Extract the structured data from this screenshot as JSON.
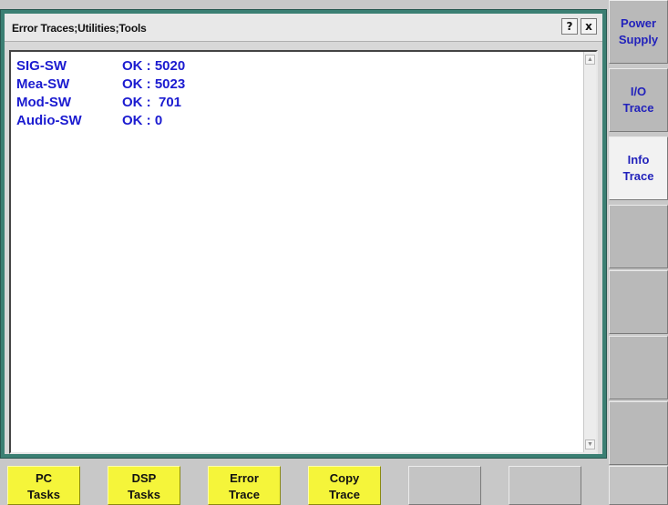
{
  "window": {
    "title": "Error Traces;Utilities;Tools",
    "help_label": "?",
    "close_label": "x"
  },
  "traces": [
    {
      "name": "SIG-SW",
      "value": "OK : 5020"
    },
    {
      "name": "Mea-SW",
      "value": "OK : 5023"
    },
    {
      "name": "Mod-SW",
      "value": "OK :  701"
    },
    {
      "name": "Audio-SW",
      "value": "OK : 0"
    }
  ],
  "side_buttons": [
    {
      "line1": "Power",
      "line2": "Supply",
      "active": false
    },
    {
      "line1": "I/O",
      "line2": "Trace",
      "active": false
    },
    {
      "line1": "Info",
      "line2": "Trace",
      "active": true
    },
    {
      "line1": "",
      "line2": "",
      "active": false
    },
    {
      "line1": "",
      "line2": "",
      "active": false
    },
    {
      "line1": "",
      "line2": "",
      "active": false
    },
    {
      "line1": "",
      "line2": "",
      "active": false
    }
  ],
  "bottom_buttons": [
    {
      "line1": "PC",
      "line2": "Tasks"
    },
    {
      "line1": "DSP",
      "line2": "Tasks"
    },
    {
      "line1": "Error",
      "line2": "Trace"
    },
    {
      "line1": "Copy",
      "line2": "Trace"
    },
    {
      "line1": "",
      "line2": ""
    },
    {
      "line1": "",
      "line2": ""
    },
    {
      "line1": "",
      "line2": ""
    }
  ],
  "colors": {
    "frame": "#3b7f73",
    "trace_text": "#1b1bd0",
    "softkey_yellow": "#f5f53a",
    "active_side": "#f2f2f2"
  }
}
